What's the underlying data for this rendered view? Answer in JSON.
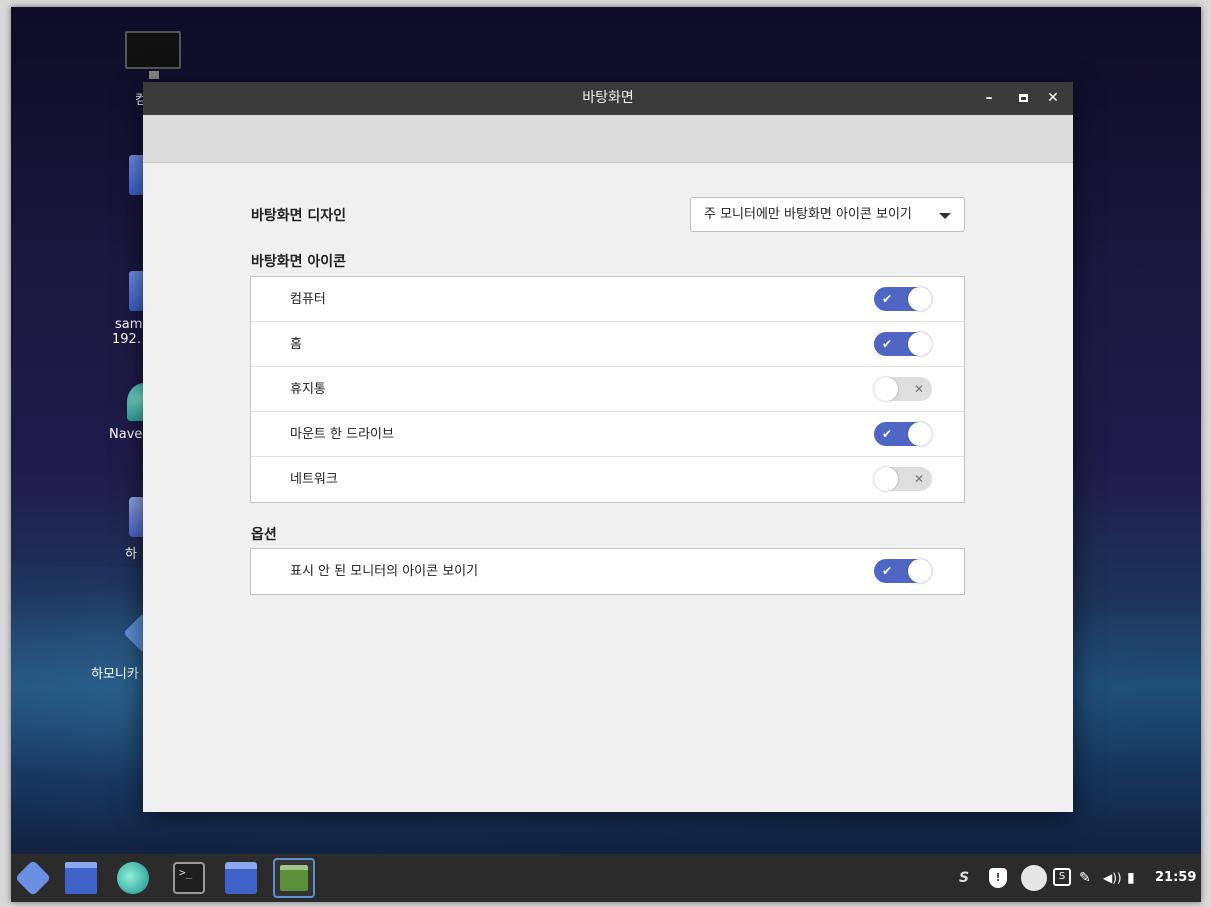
{
  "desktop": {
    "icons": [
      {
        "label": "컴",
        "icon": "monitor-icon"
      },
      {
        "label": "",
        "icon": "folder-icon"
      },
      {
        "label": "sam",
        "label2": "192.",
        "icon": "network-folder-icon"
      },
      {
        "label": "Nave",
        "icon": "naver-whale-icon"
      },
      {
        "label": "하",
        "icon": "app-icon"
      },
      {
        "label": "하모니카",
        "icon": "harmonica-icon"
      }
    ]
  },
  "window": {
    "title": "바탕화면",
    "controls": {
      "minimize": "–",
      "maximize_icon": "maximize-icon",
      "close": "✕"
    },
    "desktop_design": {
      "label": "바탕화면 디자인",
      "selected": "주 모니터에만 바탕화면 아이콘 보이기"
    },
    "desktop_icons": {
      "label": "바탕화면 아이콘",
      "items": [
        {
          "label": "컴퓨터",
          "enabled": true
        },
        {
          "label": "홈",
          "enabled": true
        },
        {
          "label": "휴지통",
          "enabled": false
        },
        {
          "label": "마운트 한 드라이브",
          "enabled": true
        },
        {
          "label": "네트워크",
          "enabled": false
        }
      ]
    },
    "options": {
      "label": "옵션",
      "items": [
        {
          "label": "표시 안 된 모니터의 아이콘 보이기",
          "enabled": true
        }
      ]
    },
    "toggle_marks": {
      "on": "✔",
      "off": "✕"
    }
  },
  "taskbar": {
    "apps": [
      "menu-icon",
      "show-desktop-icon",
      "whale-browser-icon",
      "terminal-icon",
      "file-manager-icon",
      "settings-icon"
    ],
    "terminal_glyph": ">_",
    "tray": {
      "s_glyph": "S",
      "shield_glyph": "!",
      "box_glyph": "S",
      "pen_glyph": "✎",
      "volume_glyph": "◀))",
      "network_glyph": "▮",
      "clock": "21:59"
    }
  },
  "colors": {
    "accent": "#4f66c5",
    "titlebar": "#3b3b3b",
    "taskbar": "#2b2b2b"
  }
}
